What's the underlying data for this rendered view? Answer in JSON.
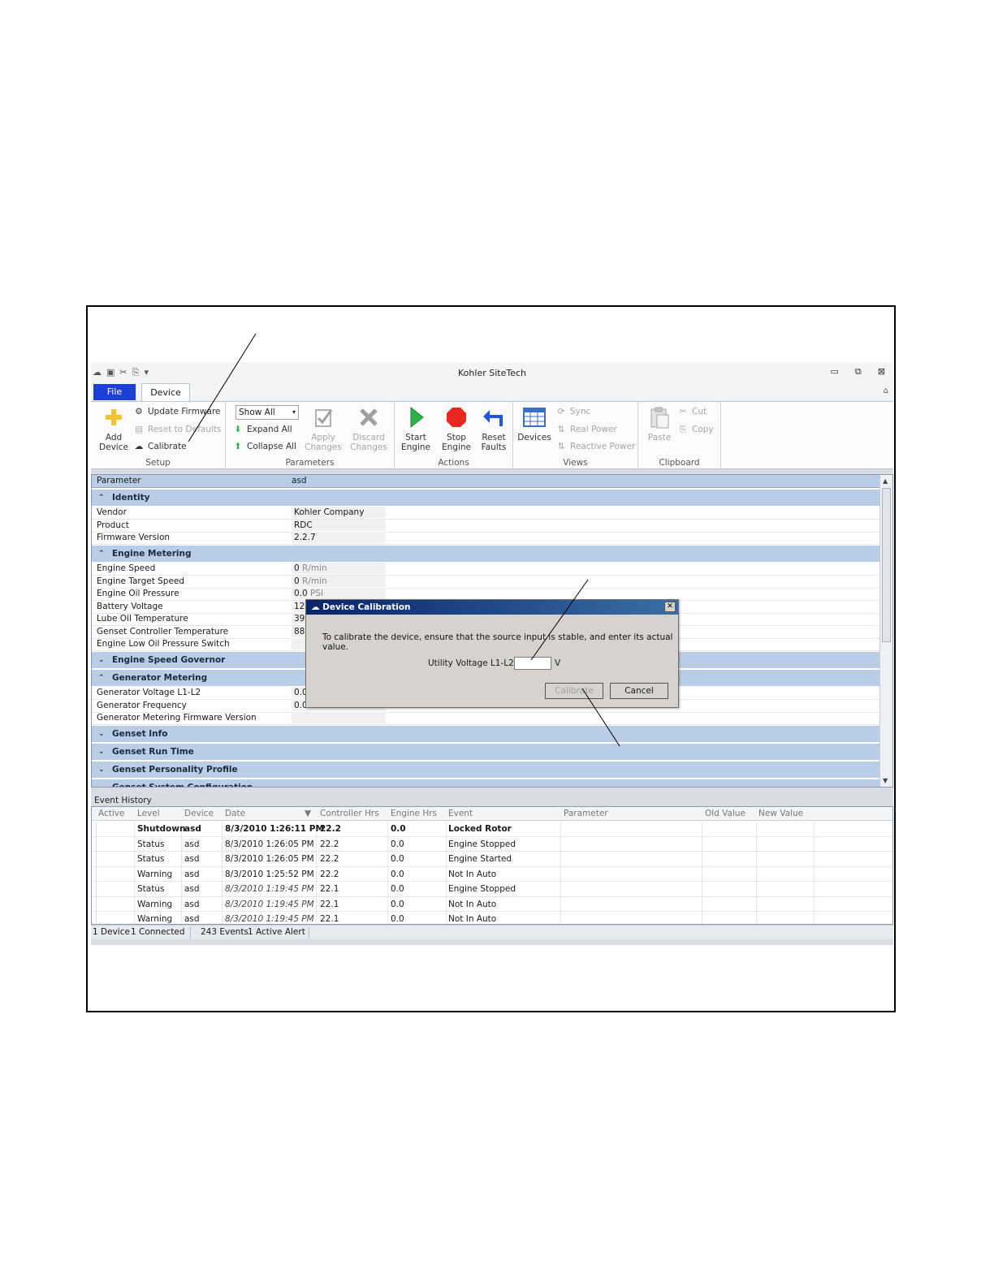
{
  "window": {
    "title": "Kohler SiteTech",
    "minimize_glyph": "▭",
    "restore_glyph": "⧉",
    "close_glyph": "⊠",
    "collapse_glyph": "⌂"
  },
  "ribbon": {
    "tabs": {
      "file": "File",
      "device": "Device"
    },
    "setup": {
      "label": "Setup",
      "add_device": [
        "Add",
        "Device"
      ],
      "update_firmware": "Update Firmware",
      "reset_defaults": "Reset to Defaults",
      "calibrate": "Calibrate"
    },
    "parameters": {
      "label": "Parameters",
      "filter_value": "Show All",
      "expand_all": "Expand All",
      "collapse_all": "Collapse All",
      "apply_changes": [
        "Apply",
        "Changes"
      ],
      "discard_changes": [
        "Discard",
        "Changes"
      ]
    },
    "actions": {
      "label": "Actions",
      "start_engine": [
        "Start",
        "Engine"
      ],
      "stop_engine": [
        "Stop",
        "Engine"
      ],
      "reset_faults": [
        "Reset",
        "Faults"
      ]
    },
    "views": {
      "label": "Views",
      "devices": "Devices",
      "sync": "Sync",
      "real_power": "Real Power",
      "reactive_power": "Reactive Power"
    },
    "clipboard": {
      "label": "Clipboard",
      "paste": "Paste",
      "cut": "Cut",
      "copy": "Copy"
    }
  },
  "grid": {
    "header": {
      "parameter": "Parameter",
      "device": "asd"
    },
    "identity": {
      "label": "Identity",
      "rows": [
        {
          "name": "Vendor",
          "value": "Kohler Company",
          "unit": ""
        },
        {
          "name": "Product",
          "value": "RDC",
          "unit": ""
        },
        {
          "name": "Firmware Version",
          "value": "2.2.7",
          "unit": ""
        }
      ]
    },
    "engine_metering": {
      "label": "Engine Metering",
      "rows": [
        {
          "name": "Engine Speed",
          "value": "0",
          "unit": "R/min"
        },
        {
          "name": "Engine Target Speed",
          "value": "0",
          "unit": "R/min"
        },
        {
          "name": "Engine Oil Pressure",
          "value": "0.0",
          "unit": "PSI"
        },
        {
          "name": "Battery Voltage",
          "value": "12",
          "unit": ""
        },
        {
          "name": "Lube Oil Temperature",
          "value": "39",
          "unit": ""
        },
        {
          "name": "Genset Controller Temperature",
          "value": "88",
          "unit": ""
        },
        {
          "name": "Engine Low Oil Pressure Switch",
          "value": "",
          "unit": ""
        }
      ]
    },
    "engine_speed_governor": {
      "label": "Engine Speed Governor"
    },
    "generator_metering": {
      "label": "Generator Metering",
      "rows": [
        {
          "name": "Generator Voltage L1-L2",
          "value": "0.0",
          "unit": ""
        },
        {
          "name": "Generator Frequency",
          "value": "0.0",
          "unit": ""
        },
        {
          "name": "Generator Metering Firmware Version",
          "value": "",
          "unit": ""
        }
      ]
    },
    "genset_info": {
      "label": "Genset Info"
    },
    "genset_run_time": {
      "label": "Genset Run Time"
    },
    "genset_personality_profile": {
      "label": "Genset Personality Profile"
    },
    "genset_system_configuration": {
      "label": "Genset System Configuration"
    }
  },
  "event_history": {
    "title": "Event History",
    "columns": [
      "Active",
      "Level",
      "Device",
      "Date",
      "Controller Hrs",
      "Engine Hrs",
      "Event",
      "Parameter",
      "Old Value",
      "New Value"
    ],
    "rows": [
      {
        "level": "Shutdown",
        "device": "asd",
        "date": "8/3/2010 1:26:11 PM",
        "controller_hrs": "22.2",
        "engine_hrs": "0.0",
        "event": "Locked Rotor"
      },
      {
        "level": "Status",
        "device": "asd",
        "date": "8/3/2010 1:26:05 PM",
        "controller_hrs": "22.2",
        "engine_hrs": "0.0",
        "event": "Engine Stopped"
      },
      {
        "level": "Status",
        "device": "asd",
        "date": "8/3/2010 1:26:05 PM",
        "controller_hrs": "22.2",
        "engine_hrs": "0.0",
        "event": "Engine Started"
      },
      {
        "level": "Warning",
        "device": "asd",
        "date": "8/3/2010 1:25:52 PM",
        "controller_hrs": "22.2",
        "engine_hrs": "0.0",
        "event": "Not In Auto"
      },
      {
        "level": "Status",
        "device": "asd",
        "date": "8/3/2010 1:19:45 PM",
        "controller_hrs": "22.1",
        "engine_hrs": "0.0",
        "event": "Engine Stopped"
      },
      {
        "level": "Warning",
        "device": "asd",
        "date": "8/3/2010 1:19:45 PM",
        "controller_hrs": "22.1",
        "engine_hrs": "0.0",
        "event": "Not In Auto"
      },
      {
        "level": "Warning",
        "device": "asd",
        "date": "8/3/2010 1:19:45 PM",
        "controller_hrs": "22.1",
        "engine_hrs": "0.0",
        "event": "Not In Auto"
      }
    ]
  },
  "status_bar": {
    "devices": "1 Device",
    "connected": "1 Connected",
    "events": "243 Events",
    "alerts": "1 Active Alert"
  },
  "dialog": {
    "title": "Device Calibration",
    "message": "To calibrate the device, ensure that the source input is stable, and enter its actual value.",
    "field_label": "Utility Voltage L1-L2:",
    "field_value": "",
    "unit": "V",
    "calibrate_button": "Calibrate",
    "cancel_button": "Cancel"
  },
  "colors": {
    "accent_file_tab": "#1e3fd6",
    "category_band": "#b9cde6",
    "dialog_title": "#0a246a",
    "stop_red": "#e8281e",
    "start_green": "#2bb34a",
    "reset_blue": "#2457d6"
  }
}
